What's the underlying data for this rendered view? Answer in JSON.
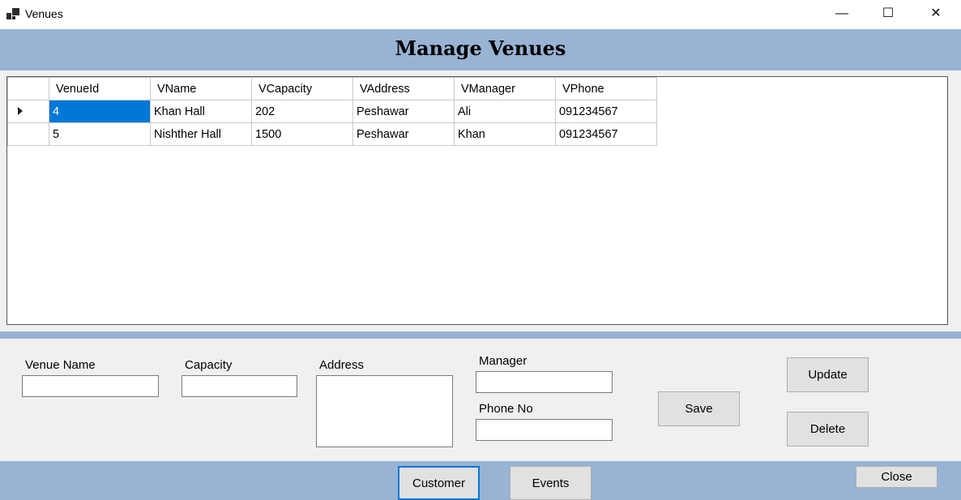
{
  "window": {
    "title": "Venues",
    "minimize_symbol": "—",
    "maximize_symbol": "☐",
    "close_symbol": "✕",
    "icon": "app-icon"
  },
  "header": {
    "title": "Manage Venues",
    "band_color": "#98b3d4"
  },
  "grid": {
    "columns": [
      "VenueId",
      "VName",
      "VCapacity",
      "VAddress",
      "VManager",
      "VPhone"
    ],
    "rows": [
      [
        "4",
        "Khan Hall",
        "202",
        "Peshawar",
        "Ali",
        "091234567"
      ],
      [
        "5",
        "Nishther Hall",
        "1500",
        "Peshawar",
        "Khan",
        "091234567"
      ]
    ],
    "selected_row": 0,
    "selection_color": "#0078d7"
  },
  "form": {
    "venue_name_label": "Venue Name",
    "venue_name_value": "",
    "capacity_label": "Capacity",
    "capacity_value": "",
    "address_label": "Address",
    "address_value": "",
    "manager_label": "Manager",
    "manager_value": "",
    "phone_label": "Phone No",
    "phone_value": "",
    "save_label": "Save",
    "update_label": "Update",
    "delete_label": "Delete"
  },
  "footer": {
    "customer_label": "Customer",
    "events_label": "Events",
    "close_label": "Close"
  }
}
